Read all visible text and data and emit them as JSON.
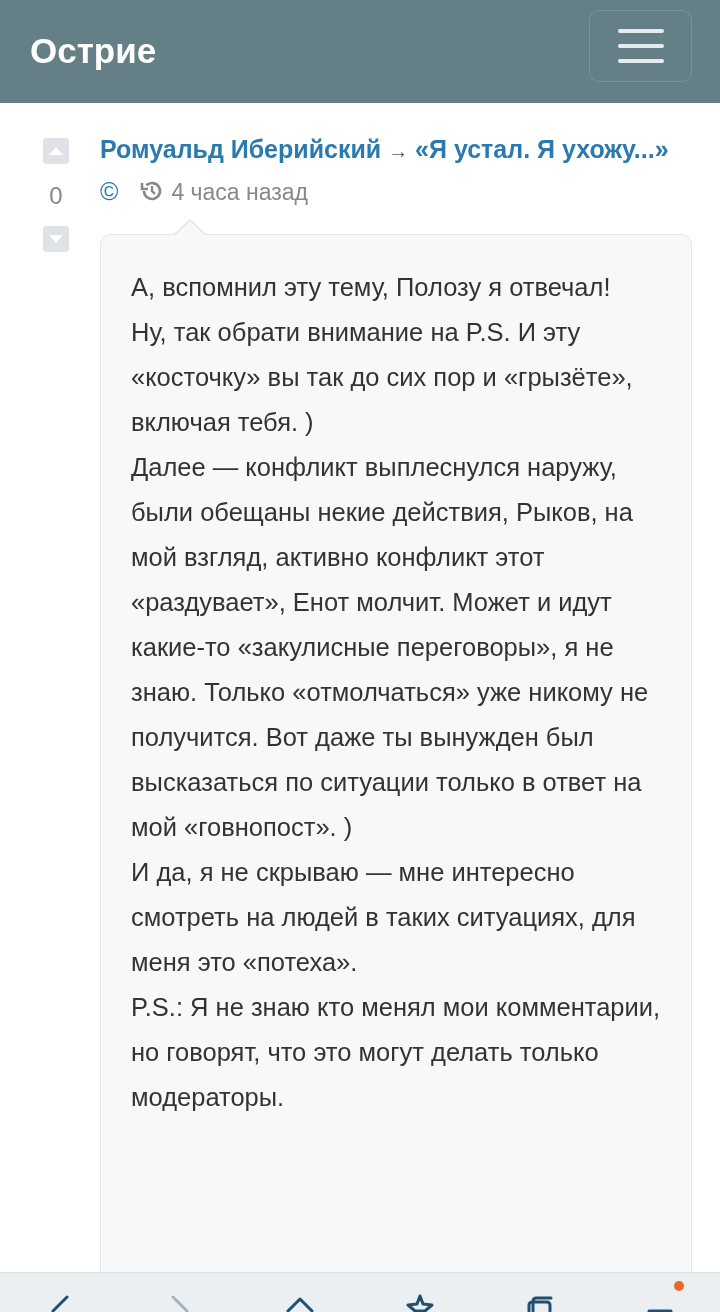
{
  "header": {
    "title": "Острие"
  },
  "comment": {
    "score": "0",
    "author": "Ромуальд Иберийский",
    "arrow": "→",
    "topic": "«Я устал. Я ухожу...»",
    "mark": "©",
    "time": "4 часа назад",
    "paragraphs": [
      "А, вспомнил эту тему, Полозу я отвечал!",
      "Ну, так обрати внимание на P.S. И эту «косточку» вы так до сих пор и «грызёте», включая тебя. )",
      "Далее — конфликт выплеснулся наружу, были обещаны некие действия, Рыков, на мой взгляд, активно конфликт этот «раздувает», Енот молчит. Может и идут какие-то «закулисные переговоры», я не знаю. Только «отмолчаться» уже никому не получится. Вот даже ты вынужден был высказаться по ситуации только в ответ на мой «говнопост». )",
      "И да, я не скрываю — мне интересно смотреть на людей в таких ситуациях, для меня это «потеха».",
      "P.S.: Я не знаю кто менял мои комментарии, но говорят, что это могут делать только модераторы."
    ]
  },
  "browser_bar": {
    "items": [
      {
        "kind": "back",
        "disabled": false
      },
      {
        "kind": "forward",
        "disabled": true
      },
      {
        "kind": "home",
        "disabled": false
      },
      {
        "kind": "star",
        "disabled": false
      },
      {
        "kind": "tabs",
        "disabled": false
      },
      {
        "kind": "menu",
        "disabled": false,
        "badge": true
      }
    ]
  }
}
